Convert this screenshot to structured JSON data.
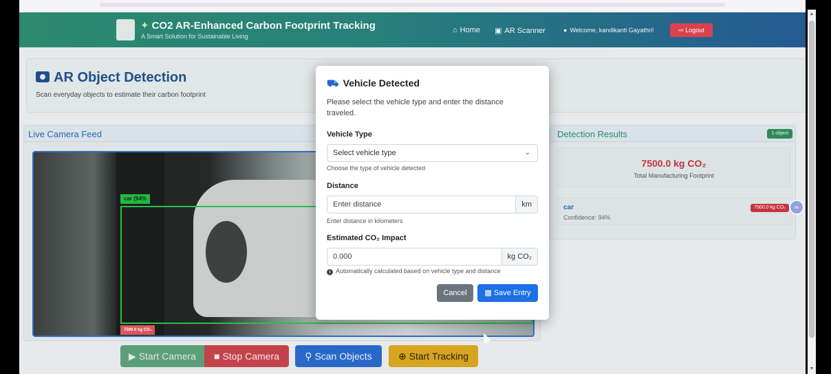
{
  "navbar": {
    "brand_icon": "sprout-icon",
    "title": "CO2 AR-Enhanced Carbon Footprint Tracking",
    "subtitle": "A Smart Solution for Sustainable Living",
    "home": "Home",
    "ar_scanner": "AR Scanner",
    "welcome": "Welcome, kandikanti Gayathri!",
    "logout": "Logout"
  },
  "header": {
    "title": "AR Object Detection",
    "subtitle": "Scan everyday objects to estimate their carbon footprint"
  },
  "camera": {
    "title": "Live Camera Feed",
    "detection_label": "car (94%",
    "co2_tag": "7500.0 kg CO₂",
    "buttons": {
      "start": "Start Camera",
      "stop": "Stop Camera",
      "scan": "Scan Objects",
      "track": "Start Tracking"
    }
  },
  "results": {
    "title": "Detection Results",
    "badge": "1 object",
    "total_value": "7500.0 kg CO₂",
    "total_label": "Total Manufacturing Footprint",
    "items": [
      {
        "name": "car",
        "confidence": "Confidence: 94%",
        "badge": "7500.0 kg CO₂"
      }
    ]
  },
  "modal": {
    "title": "Vehicle Detected",
    "description": "Please select the vehicle type and enter the distance traveled.",
    "vehicle_type_label": "Vehicle Type",
    "vehicle_type_value": "Select vehicle type",
    "vehicle_type_help": "Choose the type of vehicle detected",
    "distance_label": "Distance",
    "distance_placeholder": "Enter distance",
    "distance_unit": "km",
    "distance_help": "Enter distance in kilometers",
    "impact_label": "Estimated CO₂ Impact",
    "impact_value": "0.000",
    "impact_unit": "kg CO₂",
    "impact_help": "Automatically calculated based on vehicle type and distance",
    "cancel": "Cancel",
    "save": "Save Entry"
  },
  "colors": {
    "accent_blue": "#1f6fe5",
    "danger_red": "#c4343e",
    "success_green": "#2f8a58",
    "warning_yellow": "#d6a420"
  }
}
